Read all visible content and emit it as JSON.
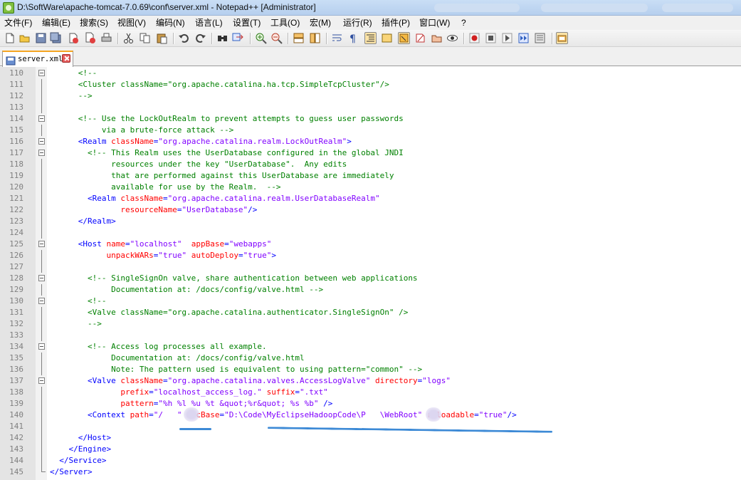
{
  "window": {
    "title": "D:\\SoftWare\\apache-tomcat-7.0.69\\conf\\server.xml - Notepad++ [Administrator]"
  },
  "menu": [
    "文件(F)",
    "编辑(E)",
    "搜索(S)",
    "视图(V)",
    "编码(N)",
    "语言(L)",
    "设置(T)",
    "工具(O)",
    "宏(M)",
    "运行(R)",
    "插件(P)",
    "窗口(W)",
    "?"
  ],
  "toolbar_icons": [
    "new-icon",
    "open-icon",
    "save-icon",
    "save-all-icon",
    "close-icon",
    "close-all-icon",
    "print-icon",
    "cut-icon",
    "copy-icon",
    "paste-icon",
    "undo-icon",
    "redo-icon",
    "find-icon",
    "replace-icon",
    "zoom-in-icon",
    "zoom-out-icon",
    "sync-vertical-icon",
    "sync-horizontal-icon",
    "word-wrap-icon",
    "show-all-chars-icon",
    "indent-guide-icon",
    "language-icon",
    "function-list-icon",
    "folder-icon",
    "monitor-icon",
    "record-macro-icon",
    "stop-macro-icon",
    "play-macro-icon",
    "run-macro-multiple-icon",
    "save-macro-icon",
    "settings-icon"
  ],
  "tab": {
    "label": "server.xml",
    "icon": "file-icon",
    "close": "close-icon"
  },
  "colors": {
    "tag": "#0000ff",
    "attr": "#ff0000",
    "value": "#8000ff",
    "comment": "#008000",
    "annotation": "#3d8ad6"
  },
  "lines": [
    {
      "n": "110",
      "segs": [
        [
          "      ",
          ""
        ],
        [
          "<!--",
          "cmt"
        ]
      ]
    },
    {
      "n": "111",
      "segs": [
        [
          "      <Cluster className=\"org.apache.catalina.ha.tcp.SimpleTcpCluster\"/>",
          "cmt"
        ]
      ]
    },
    {
      "n": "112",
      "segs": [
        [
          "      -->",
          "cmt"
        ]
      ]
    },
    {
      "n": "113",
      "segs": []
    },
    {
      "n": "114",
      "segs": [
        [
          "      <!-- Use the LockOutRealm to prevent attempts to guess user passwords",
          "cmt"
        ]
      ]
    },
    {
      "n": "115",
      "segs": [
        [
          "           via a brute-force attack -->",
          "cmt"
        ]
      ]
    },
    {
      "n": "116",
      "segs": [
        [
          "      ",
          ""
        ],
        [
          "<Realm",
          "tag"
        ],
        [
          " ",
          ""
        ],
        [
          "className",
          "attr"
        ],
        [
          "=",
          "sym"
        ],
        [
          "\"org.apache.catalina.realm.LockOutRealm\"",
          "val"
        ],
        [
          ">",
          "tag"
        ]
      ]
    },
    {
      "n": "117",
      "segs": [
        [
          "        <!-- This Realm uses the UserDatabase configured in the global JNDI",
          "cmt"
        ]
      ]
    },
    {
      "n": "118",
      "segs": [
        [
          "             resources under the key \"UserDatabase\".  Any edits",
          "cmt"
        ]
      ]
    },
    {
      "n": "119",
      "segs": [
        [
          "             that are performed against this UserDatabase are immediately",
          "cmt"
        ]
      ]
    },
    {
      "n": "120",
      "segs": [
        [
          "             available for use by the Realm.  -->",
          "cmt"
        ]
      ]
    },
    {
      "n": "121",
      "segs": [
        [
          "        ",
          ""
        ],
        [
          "<Realm",
          "tag"
        ],
        [
          " ",
          ""
        ],
        [
          "className",
          "attr"
        ],
        [
          "=",
          "sym"
        ],
        [
          "\"org.apache.catalina.realm.UserDatabaseRealm\"",
          "val"
        ]
      ]
    },
    {
      "n": "122",
      "segs": [
        [
          "               ",
          ""
        ],
        [
          "resourceName",
          "attr"
        ],
        [
          "=",
          "sym"
        ],
        [
          "\"UserDatabase\"",
          "val"
        ],
        [
          "/>",
          "tag"
        ]
      ]
    },
    {
      "n": "123",
      "segs": [
        [
          "      ",
          ""
        ],
        [
          "</Realm>",
          "tag"
        ]
      ]
    },
    {
      "n": "124",
      "segs": []
    },
    {
      "n": "125",
      "segs": [
        [
          "      ",
          ""
        ],
        [
          "<Host",
          "tag"
        ],
        [
          " ",
          ""
        ],
        [
          "name",
          "attr"
        ],
        [
          "=",
          "sym"
        ],
        [
          "\"localhost\"",
          "val"
        ],
        [
          "  ",
          ""
        ],
        [
          "appBase",
          "attr"
        ],
        [
          "=",
          "sym"
        ],
        [
          "\"webapps\"",
          "val"
        ]
      ]
    },
    {
      "n": "126",
      "segs": [
        [
          "            ",
          ""
        ],
        [
          "unpackWARs",
          "attr"
        ],
        [
          "=",
          "sym"
        ],
        [
          "\"true\"",
          "val"
        ],
        [
          " ",
          ""
        ],
        [
          "autoDeploy",
          "attr"
        ],
        [
          "=",
          "sym"
        ],
        [
          "\"true\"",
          "val"
        ],
        [
          ">",
          "tag"
        ]
      ]
    },
    {
      "n": "127",
      "segs": []
    },
    {
      "n": "128",
      "segs": [
        [
          "        <!-- SingleSignOn valve, share authentication between web applications",
          "cmt"
        ]
      ]
    },
    {
      "n": "129",
      "segs": [
        [
          "             Documentation at: /docs/config/valve.html -->",
          "cmt"
        ]
      ]
    },
    {
      "n": "130",
      "segs": [
        [
          "        <!--",
          "cmt"
        ]
      ]
    },
    {
      "n": "131",
      "segs": [
        [
          "        <Valve className=\"org.apache.catalina.authenticator.SingleSignOn\" />",
          "cmt"
        ]
      ]
    },
    {
      "n": "132",
      "segs": [
        [
          "        -->",
          "cmt"
        ]
      ]
    },
    {
      "n": "133",
      "segs": []
    },
    {
      "n": "134",
      "segs": [
        [
          "        <!-- Access log processes all example.",
          "cmt"
        ]
      ]
    },
    {
      "n": "135",
      "segs": [
        [
          "             Documentation at: /docs/config/valve.html",
          "cmt"
        ]
      ]
    },
    {
      "n": "136",
      "segs": [
        [
          "             Note: The pattern used is equivalent to using pattern=\"common\" -->",
          "cmt"
        ]
      ]
    },
    {
      "n": "137",
      "segs": [
        [
          "        ",
          ""
        ],
        [
          "<Valve",
          "tag"
        ],
        [
          " ",
          ""
        ],
        [
          "className",
          "attr"
        ],
        [
          "=",
          "sym"
        ],
        [
          "\"org.apache.catalina.valves.AccessLogValve\"",
          "val"
        ],
        [
          " ",
          ""
        ],
        [
          "directory",
          "attr"
        ],
        [
          "=",
          "sym"
        ],
        [
          "\"logs\"",
          "val"
        ]
      ]
    },
    {
      "n": "138",
      "segs": [
        [
          "               ",
          ""
        ],
        [
          "prefix",
          "attr"
        ],
        [
          "=",
          "sym"
        ],
        [
          "\"localhost_access_log.\"",
          "val"
        ],
        [
          " ",
          ""
        ],
        [
          "suffix",
          "attr"
        ],
        [
          "=",
          "sym"
        ],
        [
          "\".txt\"",
          "val"
        ]
      ]
    },
    {
      "n": "139",
      "segs": [
        [
          "               ",
          ""
        ],
        [
          "pattern",
          "attr"
        ],
        [
          "=",
          "sym"
        ],
        [
          "\"%h %l %u %t &quot;%r&quot; %s %b\"",
          "val"
        ],
        [
          " ",
          ""
        ],
        [
          "/>",
          "tag"
        ]
      ]
    },
    {
      "n": "140",
      "segs": [
        [
          "        ",
          ""
        ],
        [
          "<Context",
          "tag"
        ],
        [
          " ",
          ""
        ],
        [
          "path",
          "attr"
        ],
        [
          "=",
          "sym"
        ],
        [
          "\"/   \"",
          "val"
        ],
        [
          " ",
          ""
        ],
        [
          "docBase",
          "attr"
        ],
        [
          "=",
          "sym"
        ],
        [
          "\"D:\\Code\\MyEclipseHadoopCode\\P   \\WebRoot\"",
          "val"
        ],
        [
          " ",
          ""
        ],
        [
          "reloadable",
          "attr"
        ],
        [
          "=",
          "sym"
        ],
        [
          "\"true\"",
          "val"
        ],
        [
          "/>",
          "tag"
        ]
      ]
    },
    {
      "n": "141",
      "segs": []
    },
    {
      "n": "142",
      "segs": [
        [
          "      ",
          ""
        ],
        [
          "</Host>",
          "tag"
        ]
      ]
    },
    {
      "n": "143",
      "segs": [
        [
          "    ",
          ""
        ],
        [
          "</Engine>",
          "tag"
        ]
      ]
    },
    {
      "n": "144",
      "segs": [
        [
          "  ",
          ""
        ],
        [
          "</Service>",
          "tag"
        ]
      ]
    },
    {
      "n": "145",
      "segs": [
        [
          "",
          ""
        ],
        [
          "</Server>",
          "tag"
        ]
      ]
    }
  ]
}
